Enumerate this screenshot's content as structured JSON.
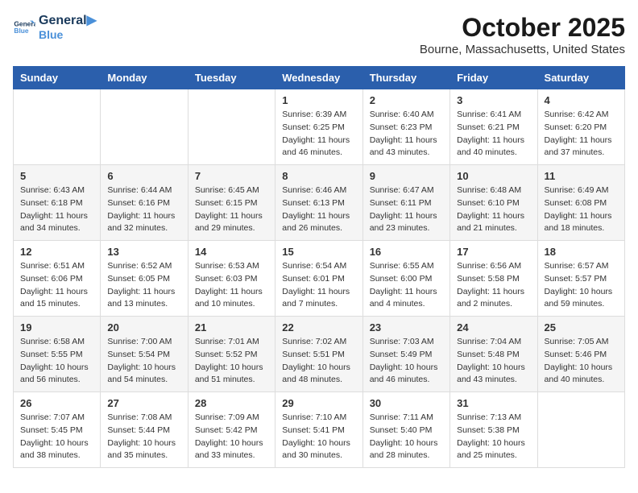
{
  "header": {
    "logo": {
      "line1": "General",
      "line2": "Blue"
    },
    "month": "October 2025",
    "location": "Bourne, Massachusetts, United States"
  },
  "weekdays": [
    "Sunday",
    "Monday",
    "Tuesday",
    "Wednesday",
    "Thursday",
    "Friday",
    "Saturday"
  ],
  "weeks": [
    [
      {
        "day": "",
        "info": ""
      },
      {
        "day": "",
        "info": ""
      },
      {
        "day": "",
        "info": ""
      },
      {
        "day": "1",
        "info": "Sunrise: 6:39 AM\nSunset: 6:25 PM\nDaylight: 11 hours\nand 46 minutes."
      },
      {
        "day": "2",
        "info": "Sunrise: 6:40 AM\nSunset: 6:23 PM\nDaylight: 11 hours\nand 43 minutes."
      },
      {
        "day": "3",
        "info": "Sunrise: 6:41 AM\nSunset: 6:21 PM\nDaylight: 11 hours\nand 40 minutes."
      },
      {
        "day": "4",
        "info": "Sunrise: 6:42 AM\nSunset: 6:20 PM\nDaylight: 11 hours\nand 37 minutes."
      }
    ],
    [
      {
        "day": "5",
        "info": "Sunrise: 6:43 AM\nSunset: 6:18 PM\nDaylight: 11 hours\nand 34 minutes."
      },
      {
        "day": "6",
        "info": "Sunrise: 6:44 AM\nSunset: 6:16 PM\nDaylight: 11 hours\nand 32 minutes."
      },
      {
        "day": "7",
        "info": "Sunrise: 6:45 AM\nSunset: 6:15 PM\nDaylight: 11 hours\nand 29 minutes."
      },
      {
        "day": "8",
        "info": "Sunrise: 6:46 AM\nSunset: 6:13 PM\nDaylight: 11 hours\nand 26 minutes."
      },
      {
        "day": "9",
        "info": "Sunrise: 6:47 AM\nSunset: 6:11 PM\nDaylight: 11 hours\nand 23 minutes."
      },
      {
        "day": "10",
        "info": "Sunrise: 6:48 AM\nSunset: 6:10 PM\nDaylight: 11 hours\nand 21 minutes."
      },
      {
        "day": "11",
        "info": "Sunrise: 6:49 AM\nSunset: 6:08 PM\nDaylight: 11 hours\nand 18 minutes."
      }
    ],
    [
      {
        "day": "12",
        "info": "Sunrise: 6:51 AM\nSunset: 6:06 PM\nDaylight: 11 hours\nand 15 minutes."
      },
      {
        "day": "13",
        "info": "Sunrise: 6:52 AM\nSunset: 6:05 PM\nDaylight: 11 hours\nand 13 minutes."
      },
      {
        "day": "14",
        "info": "Sunrise: 6:53 AM\nSunset: 6:03 PM\nDaylight: 11 hours\nand 10 minutes."
      },
      {
        "day": "15",
        "info": "Sunrise: 6:54 AM\nSunset: 6:01 PM\nDaylight: 11 hours\nand 7 minutes."
      },
      {
        "day": "16",
        "info": "Sunrise: 6:55 AM\nSunset: 6:00 PM\nDaylight: 11 hours\nand 4 minutes."
      },
      {
        "day": "17",
        "info": "Sunrise: 6:56 AM\nSunset: 5:58 PM\nDaylight: 11 hours\nand 2 minutes."
      },
      {
        "day": "18",
        "info": "Sunrise: 6:57 AM\nSunset: 5:57 PM\nDaylight: 10 hours\nand 59 minutes."
      }
    ],
    [
      {
        "day": "19",
        "info": "Sunrise: 6:58 AM\nSunset: 5:55 PM\nDaylight: 10 hours\nand 56 minutes."
      },
      {
        "day": "20",
        "info": "Sunrise: 7:00 AM\nSunset: 5:54 PM\nDaylight: 10 hours\nand 54 minutes."
      },
      {
        "day": "21",
        "info": "Sunrise: 7:01 AM\nSunset: 5:52 PM\nDaylight: 10 hours\nand 51 minutes."
      },
      {
        "day": "22",
        "info": "Sunrise: 7:02 AM\nSunset: 5:51 PM\nDaylight: 10 hours\nand 48 minutes."
      },
      {
        "day": "23",
        "info": "Sunrise: 7:03 AM\nSunset: 5:49 PM\nDaylight: 10 hours\nand 46 minutes."
      },
      {
        "day": "24",
        "info": "Sunrise: 7:04 AM\nSunset: 5:48 PM\nDaylight: 10 hours\nand 43 minutes."
      },
      {
        "day": "25",
        "info": "Sunrise: 7:05 AM\nSunset: 5:46 PM\nDaylight: 10 hours\nand 40 minutes."
      }
    ],
    [
      {
        "day": "26",
        "info": "Sunrise: 7:07 AM\nSunset: 5:45 PM\nDaylight: 10 hours\nand 38 minutes."
      },
      {
        "day": "27",
        "info": "Sunrise: 7:08 AM\nSunset: 5:44 PM\nDaylight: 10 hours\nand 35 minutes."
      },
      {
        "day": "28",
        "info": "Sunrise: 7:09 AM\nSunset: 5:42 PM\nDaylight: 10 hours\nand 33 minutes."
      },
      {
        "day": "29",
        "info": "Sunrise: 7:10 AM\nSunset: 5:41 PM\nDaylight: 10 hours\nand 30 minutes."
      },
      {
        "day": "30",
        "info": "Sunrise: 7:11 AM\nSunset: 5:40 PM\nDaylight: 10 hours\nand 28 minutes."
      },
      {
        "day": "31",
        "info": "Sunrise: 7:13 AM\nSunset: 5:38 PM\nDaylight: 10 hours\nand 25 minutes."
      },
      {
        "day": "",
        "info": ""
      }
    ]
  ]
}
